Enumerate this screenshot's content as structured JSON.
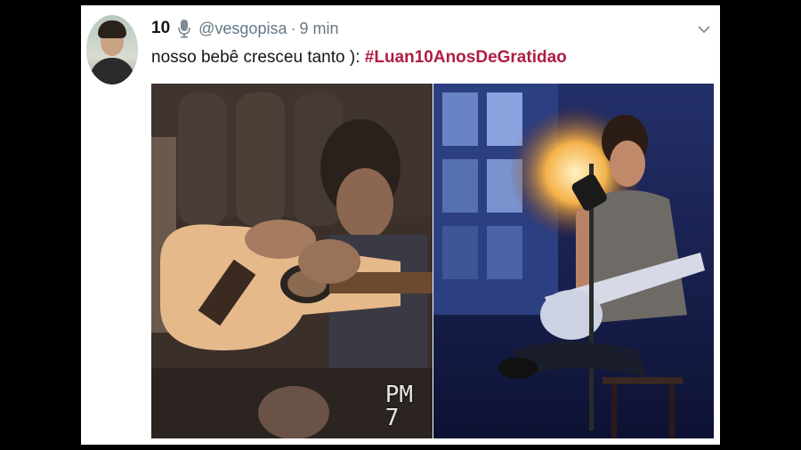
{
  "tweet": {
    "display_name": "10",
    "handle": "@vesgopisa",
    "separator": "·",
    "time": "9 min",
    "text": "nosso bebê cresceu tanto ): ",
    "hashtag": "#Luan10AnosDeGratidao"
  },
  "media": {
    "left": {
      "stamp_line1": "PM",
      "stamp_line2": "7"
    }
  },
  "colors": {
    "hashtag": "#b01d43",
    "secondary": "#657786",
    "primary_text": "#14171a"
  },
  "icons": {
    "badge": "microphone-icon",
    "menu": "chevron-down-icon"
  }
}
